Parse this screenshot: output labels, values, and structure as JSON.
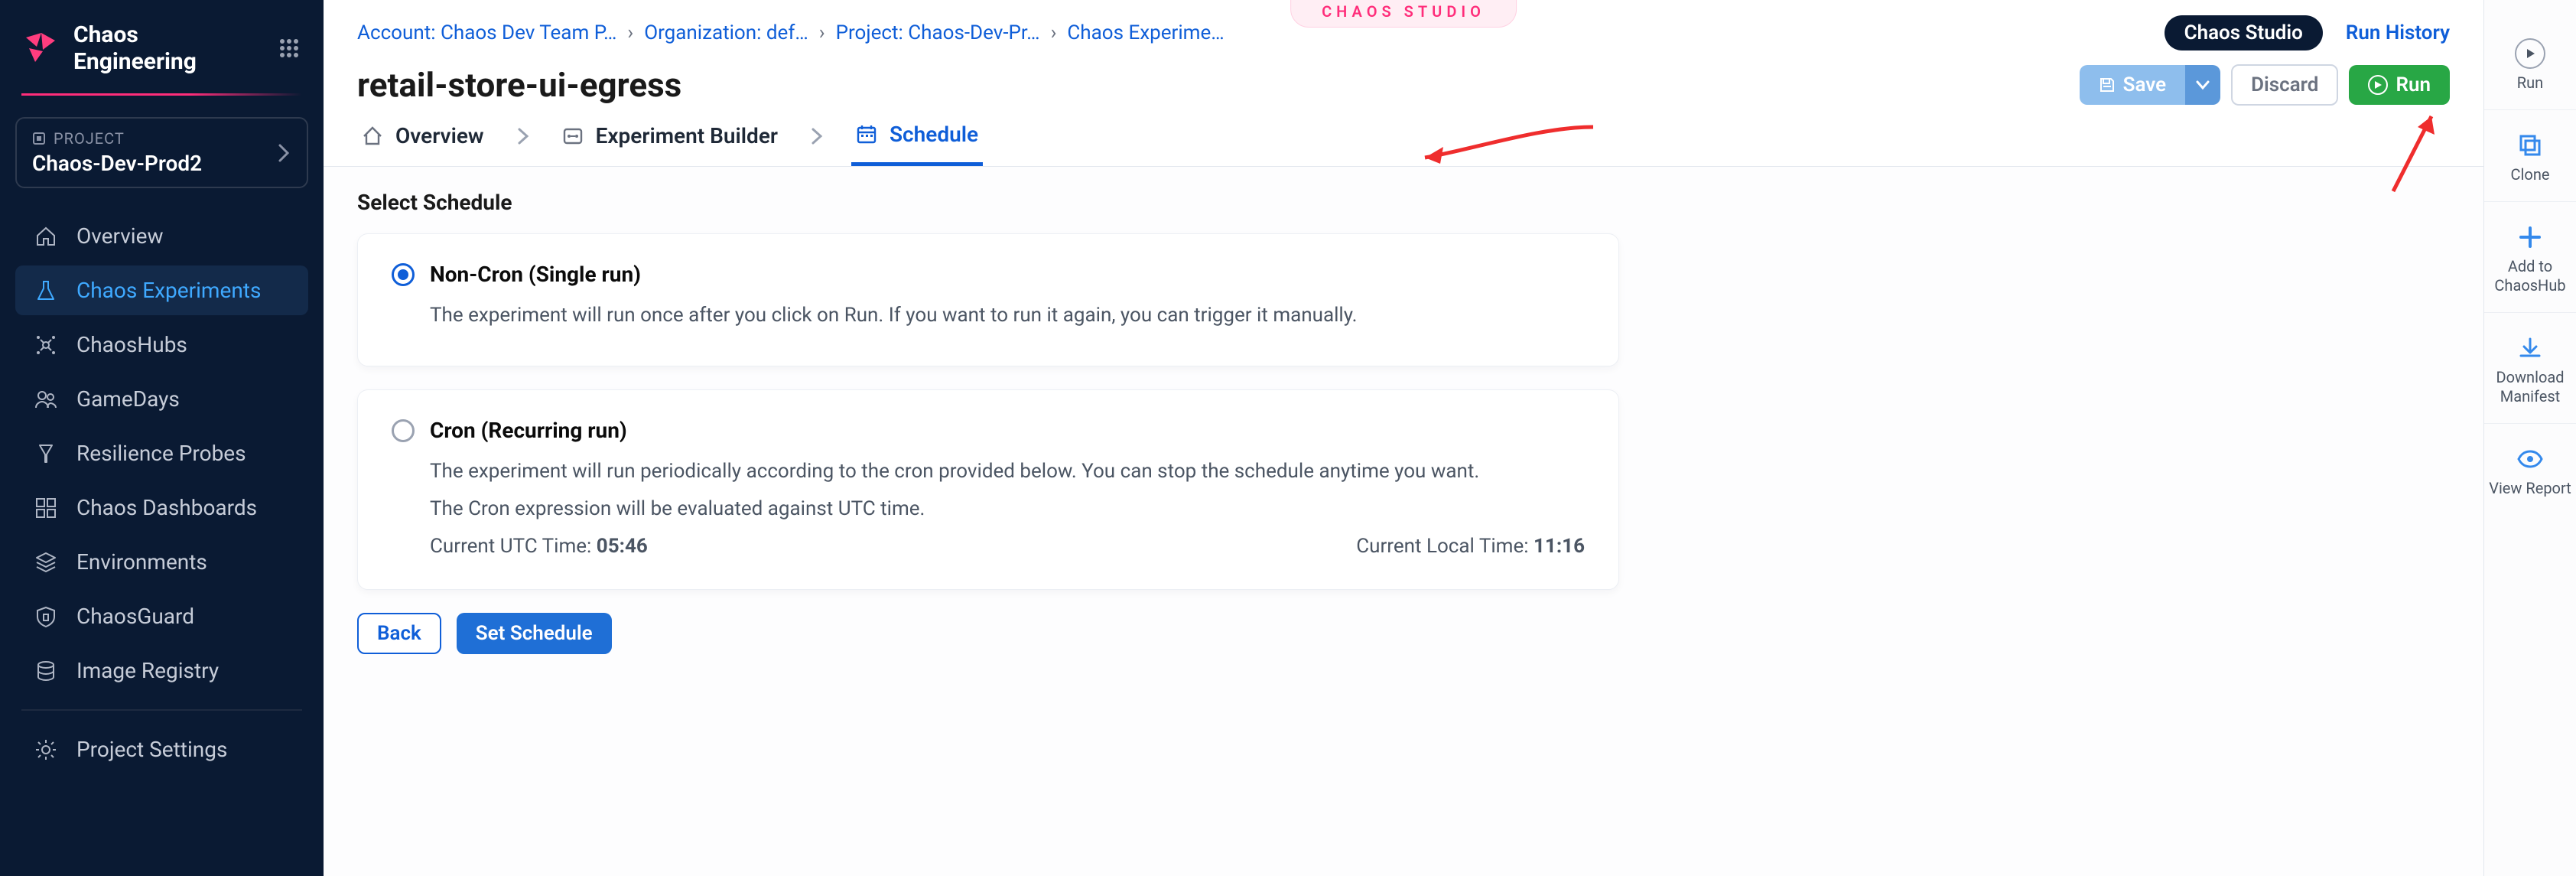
{
  "brand": {
    "title": "Chaos Engineering"
  },
  "project_selector": {
    "label": "PROJECT",
    "name": "Chaos-Dev-Prod2"
  },
  "sidebar": {
    "items": [
      {
        "label": "Overview"
      },
      {
        "label": "Chaos Experiments"
      },
      {
        "label": "ChaosHubs"
      },
      {
        "label": "GameDays"
      },
      {
        "label": "Resilience Probes"
      },
      {
        "label": "Chaos Dashboards"
      },
      {
        "label": "Environments"
      },
      {
        "label": "ChaosGuard"
      },
      {
        "label": "Image Registry"
      }
    ],
    "settings": "Project Settings"
  },
  "breadcrumbs": [
    "Account: Chaos Dev Team P…",
    "Organization: def…",
    "Project: Chaos-Dev-Pr…",
    "Chaos Experime…"
  ],
  "studio_badge": "CHAOS STUDIO",
  "header_links": {
    "chaos_studio": "Chaos Studio",
    "run_history": "Run History"
  },
  "page_title": "retail-store-ui-egress",
  "actions": {
    "save": "Save",
    "discard": "Discard",
    "run": "Run"
  },
  "steps": [
    {
      "label": "Overview"
    },
    {
      "label": "Experiment Builder"
    },
    {
      "label": "Schedule"
    }
  ],
  "schedule": {
    "section_title": "Select Schedule",
    "noncron": {
      "title": "Non-Cron (Single run)",
      "desc": "The experiment will run once after you click on Run. If you want to run it again, you can trigger it manually."
    },
    "cron": {
      "title": "Cron (Recurring run)",
      "desc1": "The experiment will run periodically according to the cron provided below. You can stop the schedule anytime you want.",
      "desc2": "The Cron expression will be evaluated against UTC time.",
      "utc_label": "Current UTC Time: ",
      "utc_value": "05:46",
      "local_label": "Current Local Time: ",
      "local_value": "11:16"
    },
    "back": "Back",
    "set": "Set Schedule"
  },
  "rail": {
    "run": "Run",
    "clone": "Clone",
    "add": "Add to ChaosHub",
    "download": "Download Manifest",
    "view": "View Report"
  }
}
